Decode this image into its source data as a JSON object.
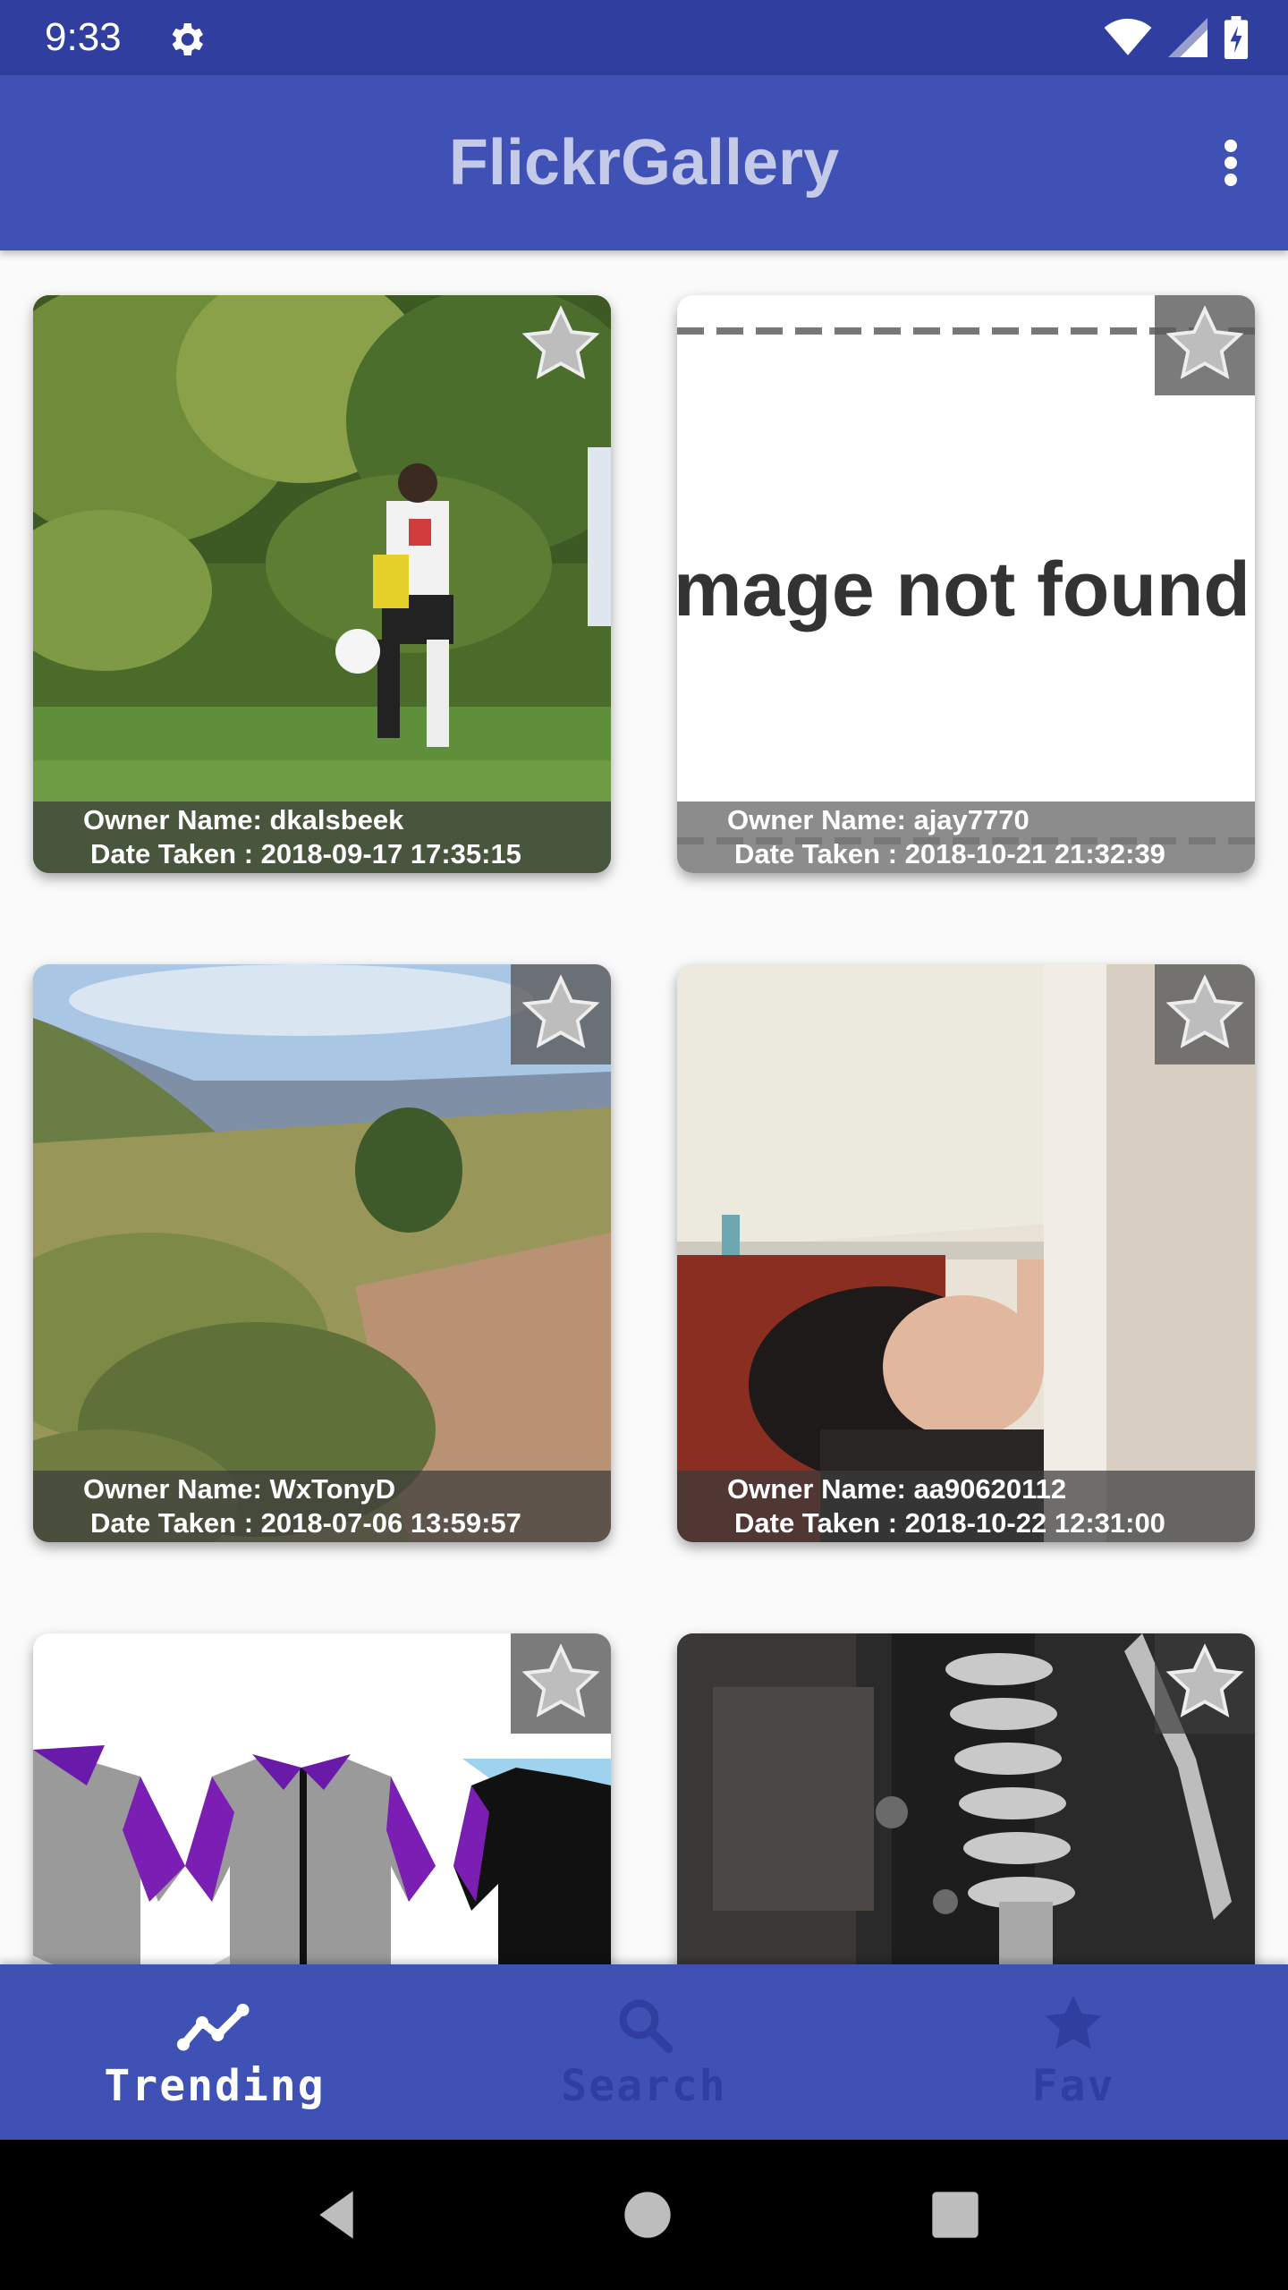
{
  "status_bar": {
    "time": "9:33",
    "icons": [
      "gear-icon",
      "wifi-icon",
      "signal-icon",
      "battery-icon"
    ]
  },
  "app_bar": {
    "title": "FlickrGallery",
    "menu_icon": "more-vert-icon"
  },
  "gallery": {
    "photos": [
      {
        "owner": "Owner Name: dkalsbeek",
        "date": "Date Taken : 2018-09-17 17:35:15",
        "favorite": false
      },
      {
        "owner": "Owner Name: ajay7770",
        "date": "Date Taken : 2018-10-21 21:32:39",
        "favorite": false,
        "image_text": "mage not found"
      },
      {
        "owner": "Owner Name: WxTonyD",
        "date": "Date Taken : 2018-07-06 13:59:57",
        "favorite": false
      },
      {
        "owner": "Owner Name: aa90620112",
        "date": "Date Taken : 2018-10-22 12:31:00",
        "favorite": false
      },
      {
        "owner": "",
        "date": "",
        "favorite": false
      },
      {
        "owner": "",
        "date": "",
        "favorite": false
      }
    ]
  },
  "bottom_nav": {
    "items": [
      {
        "label": "Trending",
        "icon": "trending-icon",
        "active": true
      },
      {
        "label": "Search",
        "icon": "search-icon",
        "active": false
      },
      {
        "label": "Fav",
        "icon": "star-icon",
        "active": false
      }
    ]
  },
  "colors": {
    "primary": "#3f51b5",
    "primary_dark": "#303f9f",
    "title_text": "#c5cae9"
  }
}
